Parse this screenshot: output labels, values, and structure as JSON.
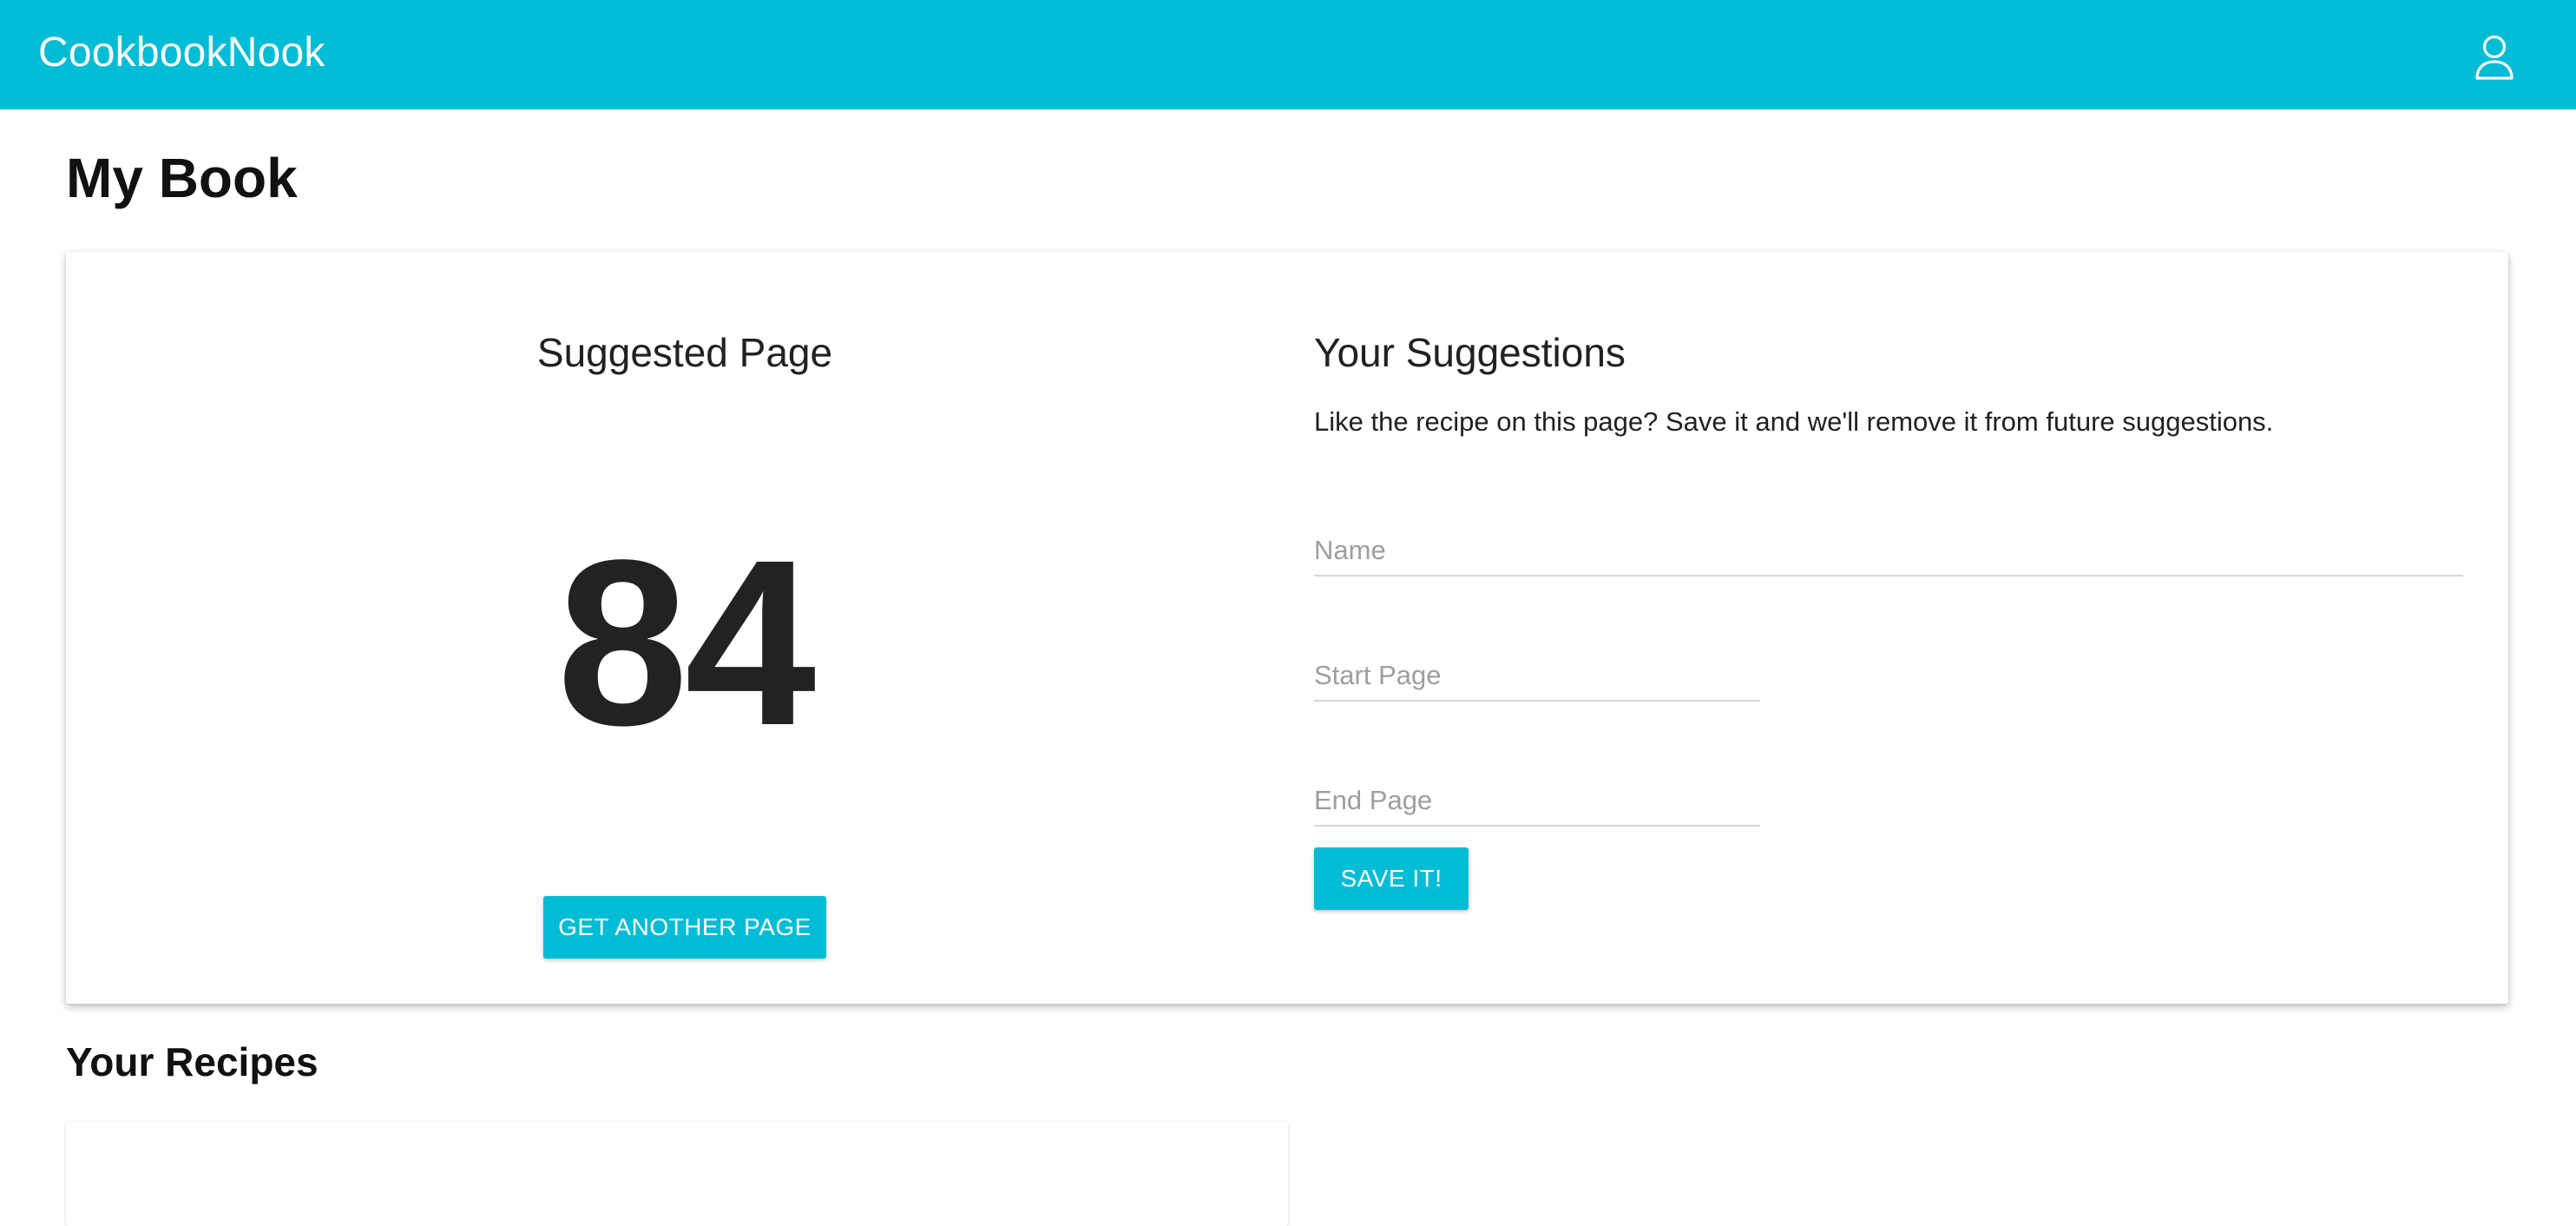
{
  "app": {
    "brand": "CookbookNook",
    "accent_color": "#00bcd4",
    "account_icon": "user-outline-icon"
  },
  "page": {
    "title": "My Book"
  },
  "suggested": {
    "heading": "Suggested Page",
    "page_number": "84",
    "button_label": "GET ANOTHER PAGE"
  },
  "suggestions": {
    "heading": "Your Suggestions",
    "helper_text": "Like the recipe on this page? Save it and we'll remove it from future suggestions.",
    "fields": {
      "name": {
        "placeholder": "Name",
        "value": ""
      },
      "start_page": {
        "placeholder": "Start Page",
        "value": ""
      },
      "end_page": {
        "placeholder": "End Page",
        "value": ""
      }
    },
    "save_label": "SAVE IT!"
  },
  "recipes": {
    "heading": "Your Recipes"
  }
}
